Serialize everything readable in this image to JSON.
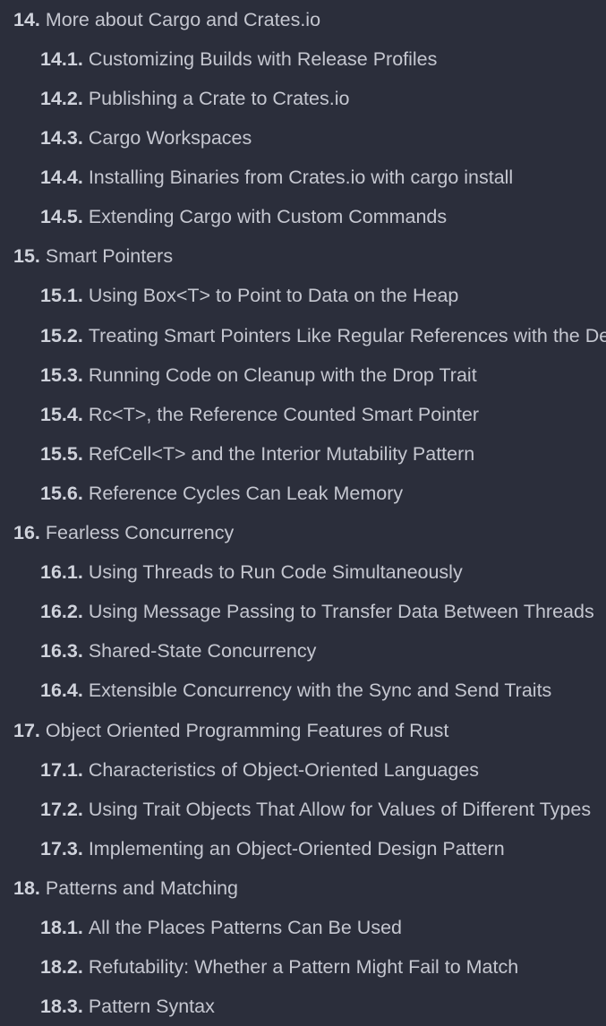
{
  "toc": {
    "items": [
      {
        "num": "14.",
        "title": "More about Cargo and Crates.io",
        "level": 1
      },
      {
        "num": "14.1.",
        "title": "Customizing Builds with Release Profiles",
        "level": 2
      },
      {
        "num": "14.2.",
        "title": "Publishing a Crate to Crates.io",
        "level": 2
      },
      {
        "num": "14.3.",
        "title": "Cargo Workspaces",
        "level": 2
      },
      {
        "num": "14.4.",
        "title": "Installing Binaries from Crates.io with cargo install",
        "level": 2
      },
      {
        "num": "14.5.",
        "title": "Extending Cargo with Custom Commands",
        "level": 2
      },
      {
        "num": "15.",
        "title": "Smart Pointers",
        "level": 1
      },
      {
        "num": "15.1.",
        "title": "Using Box<T> to Point to Data on the Heap",
        "level": 2
      },
      {
        "num": "15.2.",
        "title": "Treating Smart Pointers Like Regular References with the Deref Trait",
        "level": 2
      },
      {
        "num": "15.3.",
        "title": "Running Code on Cleanup with the Drop Trait",
        "level": 2
      },
      {
        "num": "15.4.",
        "title": "Rc<T>, the Reference Counted Smart Pointer",
        "level": 2
      },
      {
        "num": "15.5.",
        "title": "RefCell<T> and the Interior Mutability Pattern",
        "level": 2
      },
      {
        "num": "15.6.",
        "title": "Reference Cycles Can Leak Memory",
        "level": 2
      },
      {
        "num": "16.",
        "title": "Fearless Concurrency",
        "level": 1
      },
      {
        "num": "16.1.",
        "title": "Using Threads to Run Code Simultaneously",
        "level": 2
      },
      {
        "num": "16.2.",
        "title": "Using Message Passing to Transfer Data Between Threads",
        "level": 2
      },
      {
        "num": "16.3.",
        "title": "Shared-State Concurrency",
        "level": 2
      },
      {
        "num": "16.4.",
        "title": "Extensible Concurrency with the Sync and Send Traits",
        "level": 2
      },
      {
        "num": "17.",
        "title": "Object Oriented Programming Features of Rust",
        "level": 1
      },
      {
        "num": "17.1.",
        "title": "Characteristics of Object-Oriented Languages",
        "level": 2
      },
      {
        "num": "17.2.",
        "title": "Using Trait Objects That Allow for Values of Different Types",
        "level": 2
      },
      {
        "num": "17.3.",
        "title": "Implementing an Object-Oriented Design Pattern",
        "level": 2
      },
      {
        "num": "18.",
        "title": "Patterns and Matching",
        "level": 1
      },
      {
        "num": "18.1.",
        "title": "All the Places Patterns Can Be Used",
        "level": 2
      },
      {
        "num": "18.2.",
        "title": "Refutability: Whether a Pattern Might Fail to Match",
        "level": 2
      },
      {
        "num": "18.3.",
        "title": "Pattern Syntax",
        "level": 2
      }
    ]
  }
}
